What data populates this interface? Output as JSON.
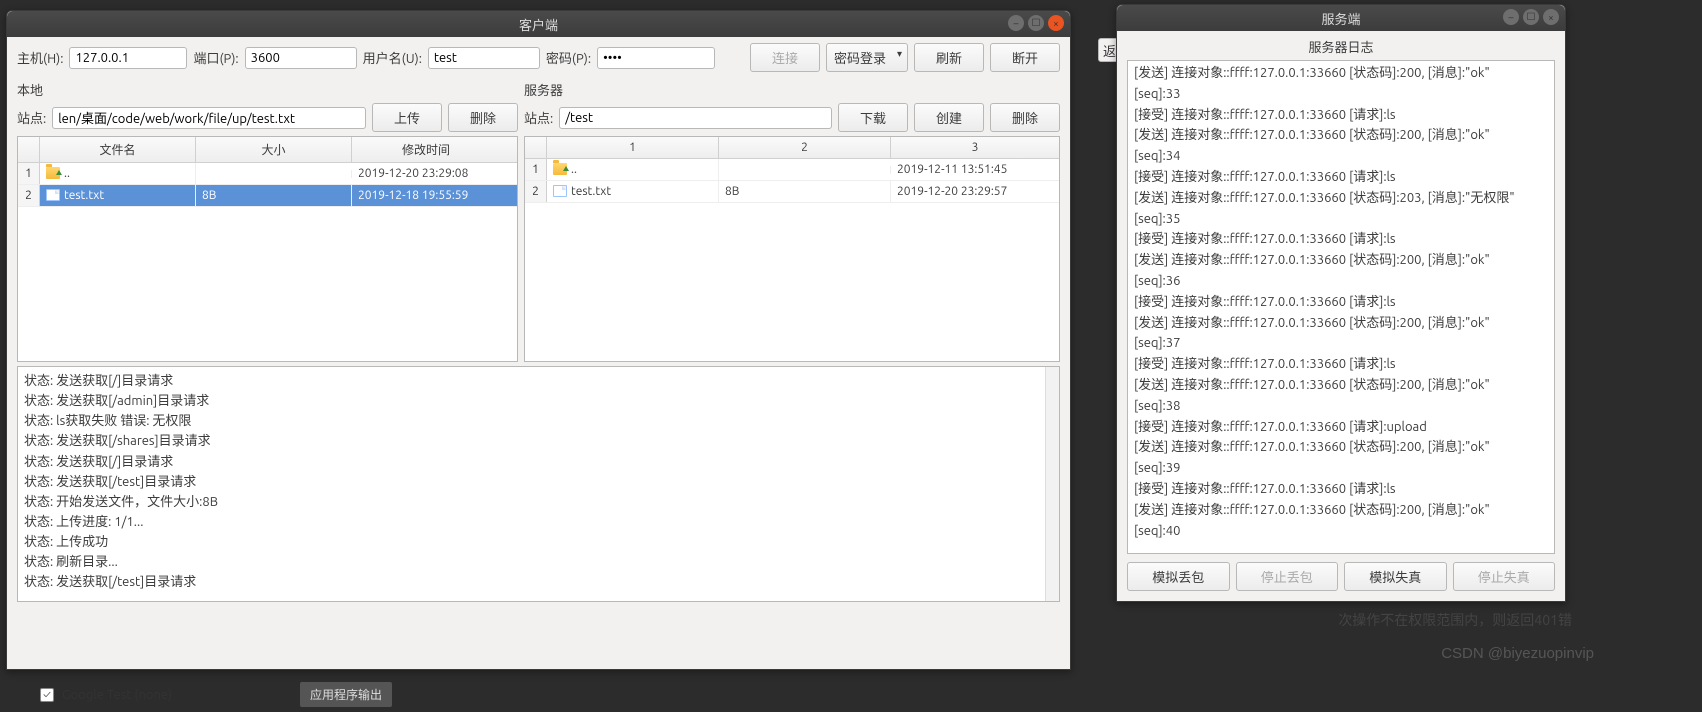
{
  "client": {
    "title": "客户端",
    "host_label": "主机(H):",
    "host_value": "127.0.0.1",
    "port_label": "端口(P):",
    "port_value": "3600",
    "user_label": "用户名(U):",
    "user_value": "test",
    "pass_label": "密码(P):",
    "pass_value": "••••",
    "btn_connect": "连接",
    "btn_login_mode": "密码登录",
    "btn_refresh": "刷新",
    "btn_disconnect": "断开",
    "local": {
      "title": "本地",
      "site_label": "站点:",
      "site_value": "len/桌面/code/web/work/file/up/test.txt",
      "btn_upload": "上传",
      "btn_delete": "删除",
      "cols": {
        "name": "文件名",
        "size": "大小",
        "time": "修改时间"
      },
      "rows": [
        {
          "rn": "1",
          "name": "..",
          "size": "",
          "time": "2019-12-20 23:29:08",
          "icon": "folder-up"
        },
        {
          "rn": "2",
          "name": "test.txt",
          "size": "8B",
          "time": "2019-12-18 19:55:59",
          "icon": "file",
          "selected": true
        }
      ]
    },
    "remote": {
      "title": "服务器",
      "site_label": "站点:",
      "site_value": "/test",
      "btn_download": "下载",
      "btn_create": "创建",
      "btn_delete": "删除",
      "cols": {
        "c1": "1",
        "c2": "2",
        "c3": "3"
      },
      "rows": [
        {
          "rn": "1",
          "c1": "..",
          "c2": "",
          "c3": "2019-12-11 13:51:45",
          "icon": "folder-up"
        },
        {
          "rn": "2",
          "c1": "test.txt",
          "c2": "8B",
          "c3": "2019-12-20 23:29:57",
          "icon": "file"
        }
      ]
    },
    "log_lines": [
      "状态:   发送获取[/]目录请求",
      "状态:   发送获取[/admin]目录请求",
      "状态:   ls获取失败 错误:   无权限",
      "状态:   发送获取[/shares]目录请求",
      "状态:   发送获取[/]目录请求",
      "状态:   发送获取[/test]目录请求",
      "状态:   开始发送文件，文件大小:8B",
      "状态:   上传进度:   1/1...",
      "状态:   上传成功",
      "状态:   刷新目录...",
      "状态:   发送获取[/test]目录请求"
    ]
  },
  "server": {
    "title": "服务端",
    "log_title": "服务器日志",
    "log_lines": [
      "[发送] 连接对象::ffff:127.0.0.1:33660  [状态码]:200, [消息]:\"ok\"",
      "[seq]:33",
      "[接受] 连接对象::ffff:127.0.0.1:33660  [请求]:ls",
      "[发送] 连接对象::ffff:127.0.0.1:33660  [状态码]:200, [消息]:\"ok\"",
      "[seq]:34",
      "[接受] 连接对象::ffff:127.0.0.1:33660  [请求]:ls",
      "[发送] 连接对象::ffff:127.0.0.1:33660  [状态码]:203, [消息]:\"无权限\"",
      "[seq]:35",
      "[接受] 连接对象::ffff:127.0.0.1:33660  [请求]:ls",
      "[发送] 连接对象::ffff:127.0.0.1:33660  [状态码]:200, [消息]:\"ok\"",
      "[seq]:36",
      "[接受] 连接对象::ffff:127.0.0.1:33660  [请求]:ls",
      "[发送] 连接对象::ffff:127.0.0.1:33660  [状态码]:200, [消息]:\"ok\"",
      "[seq]:37",
      "[接受] 连接对象::ffff:127.0.0.1:33660  [请求]:ls",
      "[发送] 连接对象::ffff:127.0.0.1:33660  [状态码]:200, [消息]:\"ok\"",
      "[seq]:38",
      "[接受] 连接对象::ffff:127.0.0.1:33660  [请求]:upload",
      "[发送] 连接对象::ffff:127.0.0.1:33660  [状态码]:200, [消息]:\"ok\"",
      "[seq]:39",
      "[接受] 连接对象::ffff:127.0.0.1:33660  [请求]:ls",
      "[发送] 连接对象::ffff:127.0.0.1:33660  [状态码]:200, [消息]:\"ok\"",
      "[seq]:40"
    ],
    "btn_sim_drop": "模拟丢包",
    "btn_stop_drop": "停止丢包",
    "btn_sim_dist": "模拟失真",
    "btn_stop_dist": "停止失真"
  },
  "background": {
    "fragment_btn": "返",
    "text_line": "次操作不在权限范围内，则返回401错",
    "taskbar_item": "Google Test (none)",
    "taskbar_btn": "应用程序输出"
  },
  "watermark": "CSDN @biyezuopinvip"
}
